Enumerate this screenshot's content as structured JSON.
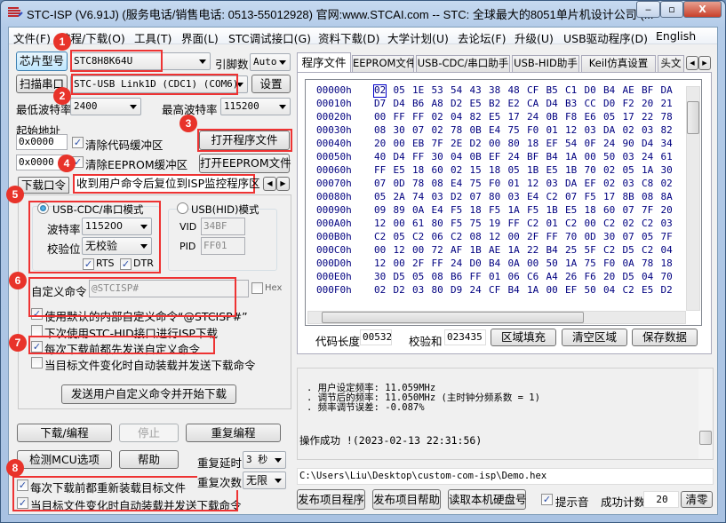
{
  "window": {
    "title": "STC-ISP (V6.91J) (服务电话/销售电话: 0513-55012928) 官网:www.STCAI.com  -- STC: 全球最大的8051单片机设计公司 (...",
    "min": "‒",
    "max": "▫",
    "close": "X"
  },
  "menu": [
    "文件(F)",
    "编程/下载(O)",
    "工具(T)",
    "界面(L)",
    "STC调试接口(G)",
    "资料下载(D)",
    "大学计划(U)",
    "去论坛(F)",
    "升级(U)",
    "USB驱动程序(D)",
    "English"
  ],
  "left": {
    "chip_button": "芯片型号",
    "chip_value": "STC8H8K64U",
    "pins_label": "引脚数",
    "pins_value": "Auto",
    "scan_button": "扫描串口",
    "port_value": "STC-USB Link1D (CDC1) (COM6)",
    "settings_button": "设置",
    "min_baud_label": "最低波特率",
    "min_baud_value": "2400",
    "max_baud_label": "最高波特率",
    "max_baud_value": "115200",
    "start_addr_label": "起始地址",
    "code_addr": "0x0000",
    "clear_code": "清除代码缓冲区",
    "eeprom_addr": "0x0000",
    "clear_eeprom": "清除EEPROM缓冲区",
    "open_prog": "打开程序文件",
    "open_eeprom": "打开EEPROM文件",
    "tab_password": "下载口令",
    "tab_reset": "收到用户命令后复位到ISP监控程序区",
    "cdc_mode": "USB-CDC/串口模式",
    "baud_label": "波特率",
    "baud_value": "115200",
    "parity_label": "校验位",
    "parity_value": "无校验",
    "rts": "RTS",
    "dtr": "DTR",
    "hid_mode": "USB(HID)模式",
    "vid_label": "VID",
    "vid_value": "34BF",
    "pid_label": "PID",
    "pid_value": "FF01",
    "custom_cmd_label": "自定义命令",
    "custom_cmd_value": "@STCISP#",
    "hex_label": "Hex",
    "use_default": "使用默认的内部自定义命令“@STCISP#”",
    "next_hid": "下次使用STC-HID接口进行ISP下载",
    "send_before": "每次下载前都先发送自定义命令",
    "auto_on_change": "当目标文件变化时自动装载并发送下载命令",
    "send_start_button": "发送用户自定义命令并开始下载",
    "download_button": "下载/编程",
    "stop_button": "停止",
    "repeat_button": "重复编程",
    "detect_button": "检测MCU选项",
    "help_button": "帮助",
    "repeat_delay_label": "重复延时",
    "repeat_delay_value": "3 秒",
    "repeat_count_label": "重复次数",
    "repeat_count_value": "无限",
    "reload_each": "每次下载前都重新装载目标文件",
    "auto_load_change": "当目标文件变化时自动装载并发送下载命令"
  },
  "badges": [
    "1",
    "2",
    "3",
    "4",
    "5",
    "6",
    "7",
    "8"
  ],
  "right": {
    "tabs": [
      "程序文件",
      "EEPROM文件",
      "USB-CDC/串口助手",
      "USB-HID助手",
      "Keil仿真设置",
      "头文"
    ],
    "hex": [
      {
        "addr": "00000h",
        "bytes": "02 05 1E 53 54 43 38 48 CF B5 C1 D0 B4 AE BF DA"
      },
      {
        "addr": "00010h",
        "bytes": "D7 D4 B6 A8 D2 E5 B2 E2 CA D4 B3 CC D0 F2 20 21"
      },
      {
        "addr": "00020h",
        "bytes": "00 FF FF 02 04 82 E5 17 24 0B F8 E6 05 17 22 78"
      },
      {
        "addr": "00030h",
        "bytes": "08 30 07 02 78 0B E4 75 F0 01 12 03 DA 02 03 82"
      },
      {
        "addr": "00040h",
        "bytes": "20 00 EB 7F 2E D2 00 80 18 EF 54 0F 24 90 D4 34"
      },
      {
        "addr": "00050h",
        "bytes": "40 D4 FF 30 04 0B EF 24 BF B4 1A 00 50 03 24 61"
      },
      {
        "addr": "00060h",
        "bytes": "FF E5 18 60 02 15 18 05 1B E5 1B 70 02 05 1A 30"
      },
      {
        "addr": "00070h",
        "bytes": "07 0D 78 08 E4 75 F0 01 12 03 DA EF 02 03 C8 02"
      },
      {
        "addr": "00080h",
        "bytes": "05 2A 74 03 D2 07 80 03 E4 C2 07 F5 17 8B 08 8A"
      },
      {
        "addr": "00090h",
        "bytes": "09 89 0A E4 F5 18 F5 1A F5 1B E5 18 60 07 7F 20"
      },
      {
        "addr": "000A0h",
        "bytes": "12 00 61 80 F5 75 19 FF C2 01 C2 00 C2 02 C2 03"
      },
      {
        "addr": "000B0h",
        "bytes": "C2 05 C2 06 C2 08 12 00 2F FF 70 0D 30 07 05 7F"
      },
      {
        "addr": "000C0h",
        "bytes": "00 12 00 72 AF 1B AE 1A 22 B4 25 5F C2 D5 C2 04"
      },
      {
        "addr": "000D0h",
        "bytes": "12 00 2F FF 24 D0 B4 0A 00 50 1A 75 F0 0A 78 18"
      },
      {
        "addr": "000E0h",
        "bytes": "30 D5 05 08 B6 FF 01 06 C6 A4 26 F6 20 D5 04 70"
      },
      {
        "addr": "000F0h",
        "bytes": "02 D2 03 80 D9 24 CF B4 1A 00 EF 50 04 C2 E5 D2"
      }
    ],
    "code_len_label": "代码长度",
    "code_len": "00532",
    "checksum_label": "校验和",
    "checksum": "023435",
    "fill_button": "区域填充",
    "clear_button": "清空区域",
    "save_button": "保存数据",
    "log": [
      ". 用户设定频率: 11.059MHz",
      ". 调节后的频率: 11.050MHz (主时钟分频系数 = 1)",
      ". 频率调节误差: -0.087%"
    ],
    "log_result": "操作成功 !(2023-02-13 22:31:56)",
    "path": "C:\\Users\\Liu\\Desktop\\custom-com-isp\\Demo.hex",
    "publish_prog": "发布项目程序",
    "publish_help": "发布项目帮助",
    "read_disk": "读取本机硬盘号",
    "beep_label": "提示音",
    "success_label": "成功计数",
    "success_count": "20",
    "reset_button": "清零"
  }
}
